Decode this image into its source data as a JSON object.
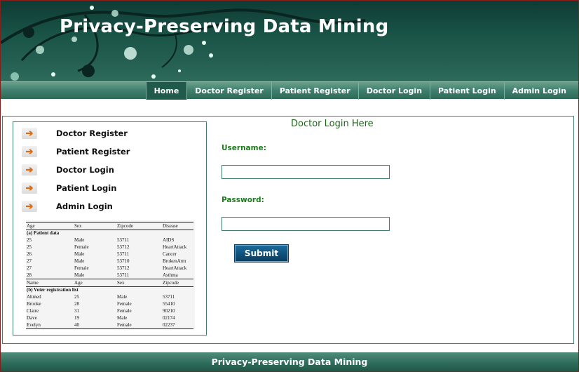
{
  "header": {
    "title": "Privacy-Preserving Data Mining"
  },
  "nav": {
    "items": [
      {
        "label": "Home",
        "active": true
      },
      {
        "label": "Doctor Register"
      },
      {
        "label": "Patient Register"
      },
      {
        "label": "Doctor Login"
      },
      {
        "label": "Patient Login"
      },
      {
        "label": "Admin Login"
      }
    ]
  },
  "sidebar": {
    "arrow_icon": "arrow-right-icon",
    "links": [
      {
        "label": "Doctor Register"
      },
      {
        "label": "Patient Register"
      },
      {
        "label": "Doctor Login"
      },
      {
        "label": "Patient Login"
      },
      {
        "label": "Admin Login"
      }
    ]
  },
  "datafig": {
    "patient_header": [
      "Age",
      "Sex",
      "Zipcode",
      "Disease"
    ],
    "patient_caption": "(a) Patient data",
    "patient_rows": [
      [
        "25",
        "Male",
        "53711",
        "AIDS"
      ],
      [
        "25",
        "Female",
        "53712",
        "HeartAttack"
      ],
      [
        "26",
        "Male",
        "53711",
        "Cancer"
      ],
      [
        "27",
        "Male",
        "53710",
        "BrokenArm"
      ],
      [
        "27",
        "Female",
        "53712",
        "HeartAttack"
      ],
      [
        "28",
        "Male",
        "53711",
        "Asthma"
      ]
    ],
    "voter_header": [
      "Name",
      "Age",
      "Sex",
      "Zipcode"
    ],
    "voter_caption": "(b) Voter registration list",
    "voter_rows": [
      [
        "Ahmed",
        "25",
        "Male",
        "53711"
      ],
      [
        "Brooke",
        "28",
        "Female",
        "55410"
      ],
      [
        "Claire",
        "31",
        "Female",
        "90210"
      ],
      [
        "Dave",
        "19",
        "Male",
        "02174"
      ],
      [
        "Evelyn",
        "40",
        "Female",
        "02237"
      ]
    ]
  },
  "login": {
    "title": "Doctor Login Here",
    "username_label": "Username:",
    "username_value": "",
    "password_label": "Password:",
    "password_value": "",
    "submit_label": "Submit"
  },
  "footer": {
    "text": "Privacy-Preserving Data Mining"
  },
  "colors": {
    "header_dark": "#0f3b34",
    "nav_green": "#3f7f6c",
    "label_green": "#1f7a1f",
    "button_blue": "#0d4f78",
    "arrow_orange": "#e06a10"
  }
}
